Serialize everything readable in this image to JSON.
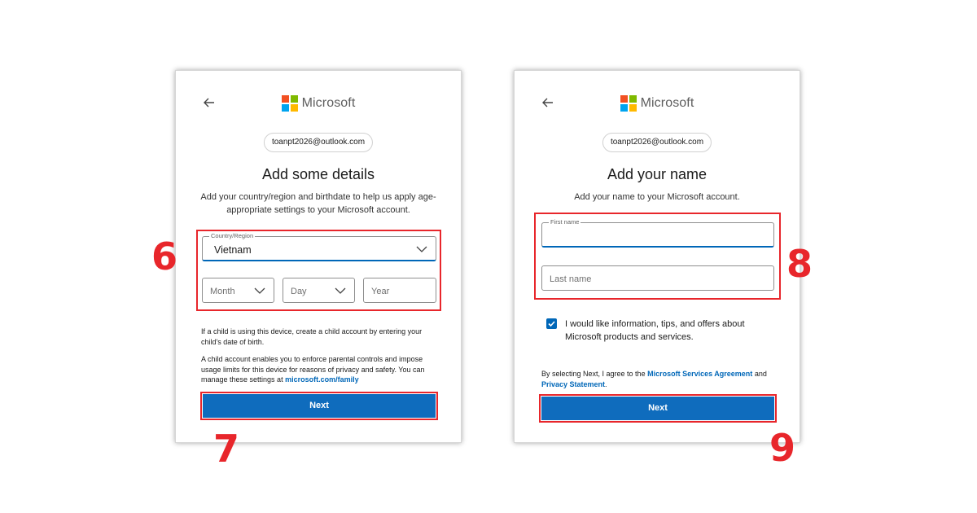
{
  "brand": {
    "name": "Microsoft",
    "logo_colors": [
      "#f25022",
      "#7fba00",
      "#00a4ef",
      "#ffb900"
    ]
  },
  "colors": {
    "accent": "#0f6cbd",
    "annotation": "#e8262b"
  },
  "left_panel": {
    "email": "toanpt2026@outlook.com",
    "heading": "Add some details",
    "subtext": "Add your country/region and birthdate to help us apply age-appropriate settings to your Microsoft account.",
    "country_label": "Country/Region",
    "country_value": "Vietnam",
    "month_placeholder": "Month",
    "day_placeholder": "Day",
    "year_placeholder": "Year",
    "child_note": "If a child is using this device, create a child account by entering your child's date of birth.",
    "child_account_note": "A child account enables you to enforce parental controls and impose usage limits for this device for reasons of privacy and safety. You can manage these settings at",
    "family_link": "microsoft.com/family",
    "next_label": "Next"
  },
  "right_panel": {
    "email": "toanpt2026@outlook.com",
    "heading": "Add your name",
    "subtext": "Add your name to your Microsoft account.",
    "first_name_label": "First name",
    "first_name_value": "",
    "last_name_placeholder": "Last name",
    "offers_checkbox_label": "I would like information, tips, and offers about Microsoft products and services.",
    "offers_checked": true,
    "agreement_prefix": "By selecting Next, I agree to the",
    "services_agreement_link": "Microsoft Services Agreement",
    "agreement_and": "and",
    "privacy_link": "Privacy Statement",
    "agreement_suffix": ".",
    "next_label": "Next"
  },
  "step_labels": {
    "step6": "6",
    "step7": "7",
    "step8": "8",
    "step9": "9"
  }
}
